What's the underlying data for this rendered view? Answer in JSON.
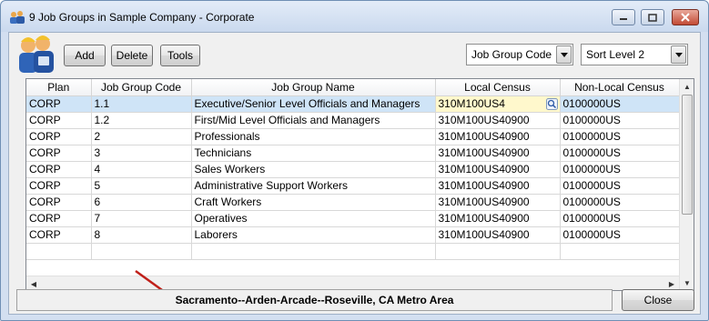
{
  "window": {
    "title": "9 Job Groups in Sample Company - Corporate",
    "icon": "people-icon"
  },
  "toolbar": {
    "add_label": "Add",
    "delete_label": "Delete",
    "tools_label": "Tools",
    "field_select": "Job Group Code",
    "sort_select": "Sort Level 2"
  },
  "grid": {
    "columns": [
      "Plan",
      "Job Group Code",
      "Job Group Name",
      "Local Census",
      "Non-Local Census"
    ],
    "rows": [
      [
        "CORP",
        "1.1",
        "Executive/Senior Level Officials and Managers",
        "310M100US4",
        "0100000US"
      ],
      [
        "CORP",
        "1.2",
        "First/Mid Level Officials and Managers",
        "310M100US40900",
        "0100000US"
      ],
      [
        "CORP",
        "2",
        "Professionals",
        "310M100US40900",
        "0100000US"
      ],
      [
        "CORP",
        "3",
        "Technicians",
        "310M100US40900",
        "0100000US"
      ],
      [
        "CORP",
        "4",
        "Sales Workers",
        "310M100US40900",
        "0100000US"
      ],
      [
        "CORP",
        "5",
        "Administrative Support Workers",
        "310M100US40900",
        "0100000US"
      ],
      [
        "CORP",
        "6",
        "Craft Workers",
        "310M100US40900",
        "0100000US"
      ],
      [
        "CORP",
        "7",
        "Operatives",
        "310M100US40900",
        "0100000US"
      ],
      [
        "CORP",
        "8",
        "Laborers",
        "310M100US40900",
        "0100000US"
      ]
    ],
    "selected_row": 0
  },
  "status": {
    "text": "Sacramento--Arden-Arcade--Roseville, CA Metro Area"
  },
  "footer": {
    "close_label": "Close"
  },
  "colors": {
    "selected_row": "#cfe4f7",
    "editing_cell": "#fff8cc",
    "annotation_arrow": "#c0201a"
  }
}
